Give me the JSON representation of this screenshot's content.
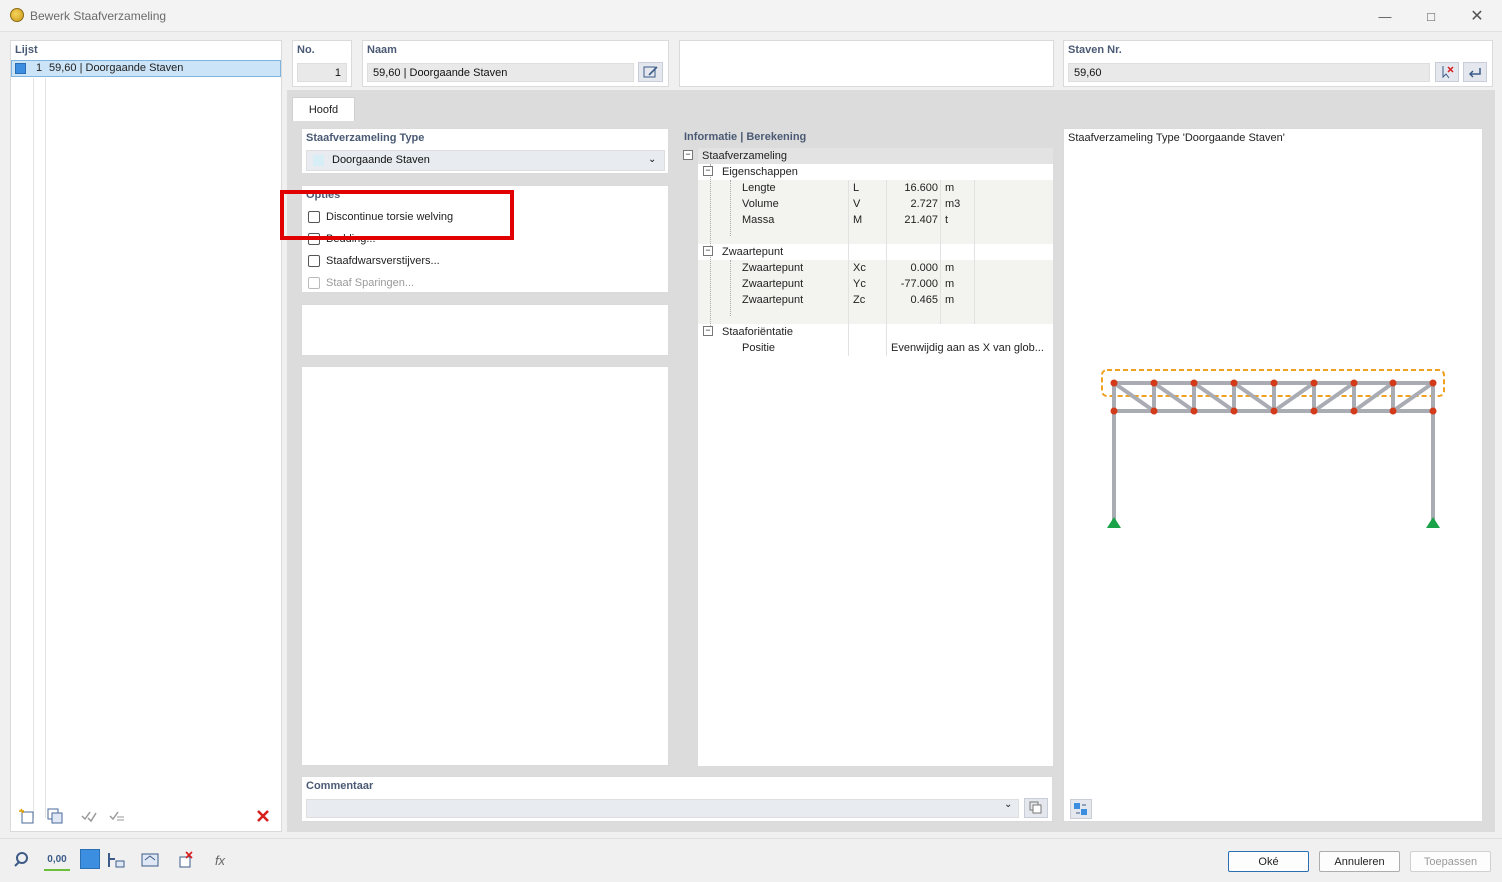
{
  "window": {
    "title": "Bewerk Staafverzameling"
  },
  "list": {
    "header": "Lijst",
    "items": [
      {
        "no": "1",
        "label": "59,60 | Doorgaande Staven"
      }
    ]
  },
  "no": {
    "label": "No.",
    "value": "1"
  },
  "naam": {
    "label": "Naam",
    "value": "59,60 | Doorgaande Staven"
  },
  "staven": {
    "label": "Staven Nr.",
    "value": "59,60"
  },
  "tabs": [
    {
      "label": "Hoofd"
    }
  ],
  "type": {
    "header": "Staafverzameling Type",
    "selected": "Doorgaande Staven"
  },
  "options": {
    "header": "Opties",
    "items": [
      {
        "label": "Discontinue torsie welving",
        "checked": false,
        "enabled": true
      },
      {
        "label": "Bedding...",
        "checked": false,
        "enabled": true
      },
      {
        "label": "Staafdwarsverstijvers...",
        "checked": false,
        "enabled": true
      },
      {
        "label": "Staaf Sparingen...",
        "checked": false,
        "enabled": false
      }
    ]
  },
  "info": {
    "header": "Informatie | Berekening",
    "root": "Staafverzameling",
    "groups": [
      {
        "title": "Eigenschappen",
        "rows": [
          {
            "name": "Lengte",
            "symbol": "L",
            "value": "16.600",
            "unit": "m"
          },
          {
            "name": "Volume",
            "symbol": "V",
            "value": "2.727",
            "unit": "m3"
          },
          {
            "name": "Massa",
            "symbol": "M",
            "value": "21.407",
            "unit": "t"
          }
        ]
      },
      {
        "title": "Zwaartepunt",
        "rows": [
          {
            "name": "Zwaartepunt",
            "symbol": "Xc",
            "value": "0.000",
            "unit": "m"
          },
          {
            "name": "Zwaartepunt",
            "symbol": "Yc",
            "value": "-77.000",
            "unit": "m"
          },
          {
            "name": "Zwaartepunt",
            "symbol": "Zc",
            "value": "0.465",
            "unit": "m"
          }
        ]
      },
      {
        "title": "Staaforiëntatie",
        "rows": [
          {
            "name": "Positie",
            "symbol": "",
            "value": "Evenwijdig aan as X van glob...",
            "unit": ""
          }
        ]
      }
    ]
  },
  "preview": {
    "title": "Staafverzameling Type 'Doorgaande Staven'"
  },
  "comment": {
    "header": "Commentaar",
    "value": ""
  },
  "footer": {
    "ok": "Oké",
    "cancel": "Annuleren",
    "apply": "Toepassen",
    "units_badge": "0,00"
  },
  "colors": {
    "accent": "#4a5a74",
    "selection": "#cce4f7",
    "highlight_box": "#e00000",
    "node": "#d23a1a",
    "support": "#1ba34a",
    "outline": "#f0a020"
  }
}
